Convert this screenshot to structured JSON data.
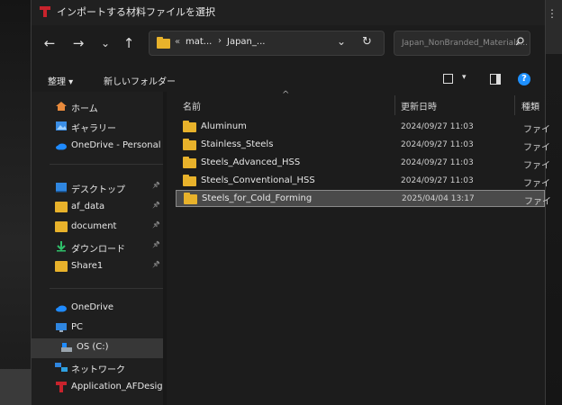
{
  "window": {
    "title": "インポートする材料ファイルを選択"
  },
  "nav": {
    "back": "←",
    "forward": "→",
    "recent": "⌄",
    "up": "↑"
  },
  "address": {
    "overflow": "«",
    "crumbs": [
      "mat...",
      "Japan_..."
    ],
    "chevron": "›",
    "dropdown": "⌄",
    "refresh": "↻"
  },
  "search": {
    "placeholder": "Japan_NonBranded_Materials..."
  },
  "toolbar": {
    "organize": "整理 ▾",
    "new_folder": "新しいフォルダー",
    "view_dropdown": "▾",
    "help": "?"
  },
  "sidebar": {
    "items": [
      {
        "label": "ホーム",
        "icon": "home-icon"
      },
      {
        "label": "ギャラリー",
        "icon": "gallery-icon"
      },
      {
        "label": "OneDrive - Personal",
        "icon": "cloud-icon"
      },
      {
        "label": "デスクトップ",
        "icon": "desktop-icon",
        "pinned": true
      },
      {
        "label": "af_data",
        "icon": "folder-icon",
        "pinned": true
      },
      {
        "label": "document",
        "icon": "folder-icon",
        "pinned": true
      },
      {
        "label": "ダウンロード",
        "icon": "download-icon",
        "pinned": true
      },
      {
        "label": "Share1",
        "icon": "folder-icon",
        "pinned": true
      },
      {
        "label": "OneDrive",
        "icon": "cloud-icon"
      },
      {
        "label": "PC",
        "icon": "pc-icon"
      },
      {
        "label": "OS (C:)",
        "icon": "drive-icon"
      },
      {
        "label": "ネットワーク",
        "icon": "network-icon"
      },
      {
        "label": "Application_AFDesig",
        "icon": "app-icon"
      }
    ],
    "pin_glyph": "📌"
  },
  "columns": {
    "name": "名前",
    "modified": "更新日時",
    "type": "種類",
    "sort_glyph": "^"
  },
  "files": [
    {
      "name": "Aluminum",
      "modified": "2024/09/27 11:03",
      "type": "ファイ"
    },
    {
      "name": "Stainless_Steels",
      "modified": "2024/09/27 11:03",
      "type": "ファイ"
    },
    {
      "name": "Steels_Advanced_HSS",
      "modified": "2024/09/27 11:03",
      "type": "ファイ"
    },
    {
      "name": "Steels_Conventional_HSS",
      "modified": "2024/09/27 11:03",
      "type": "ファイ"
    },
    {
      "name": "Steels_for_Cold_Forming",
      "modified": "2025/04/04 13:17",
      "type": "ファイ",
      "selected": true
    }
  ],
  "colors": {
    "folder": "#e8b22b",
    "accent": "#1e90ff",
    "selection": "#4a4a4a"
  }
}
